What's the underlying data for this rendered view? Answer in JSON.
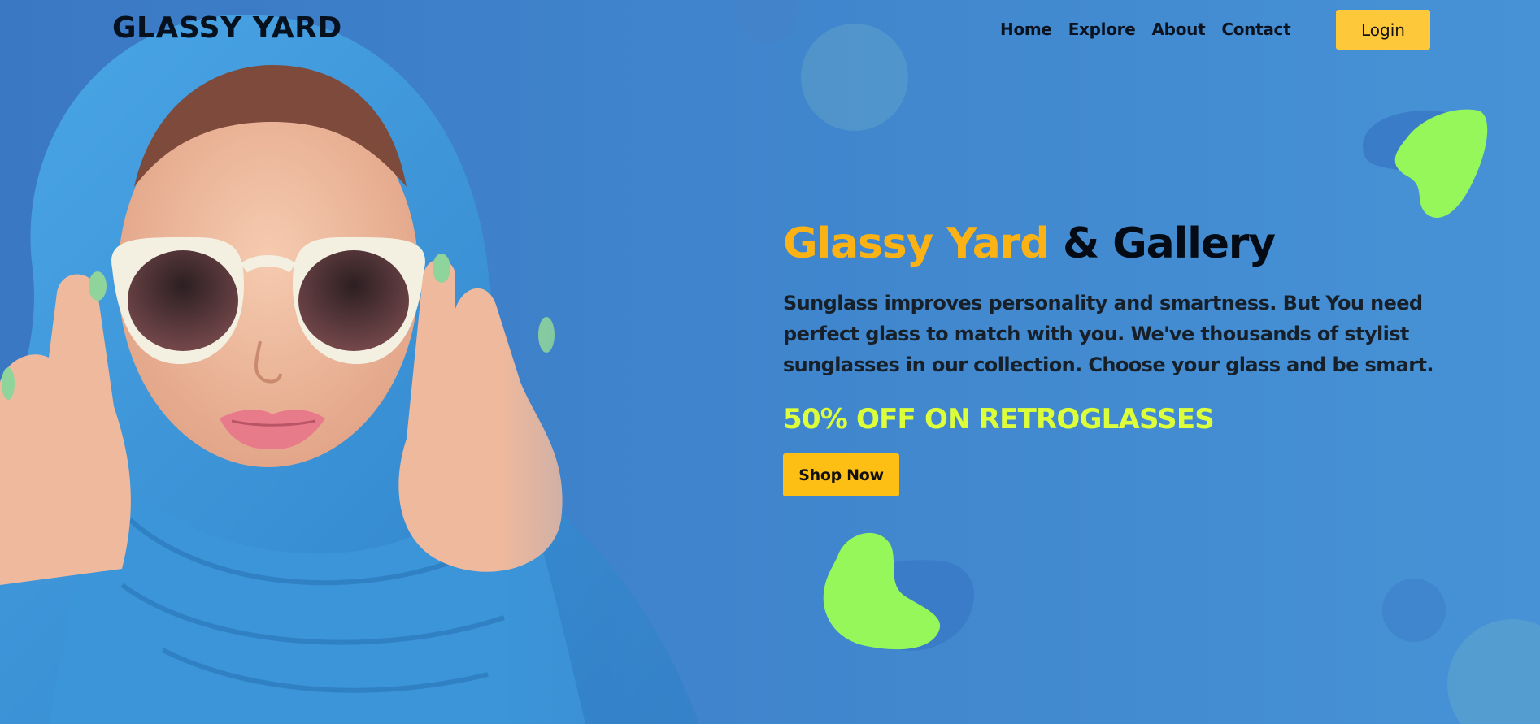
{
  "brand": {
    "logo_text": "GLASSY YARD"
  },
  "nav": {
    "items": [
      {
        "label": "Home"
      },
      {
        "label": "Explore"
      },
      {
        "label": "About"
      },
      {
        "label": "Contact"
      }
    ],
    "login_label": "Login"
  },
  "hero": {
    "title_accent": "Glassy Yard",
    "title_rest": "& Gallery",
    "description": "Sunglass improves personality and smartness. But You need perfect glass to match with you. We've thousands of stylist sunglasses in our collection. Choose your glass and be smart.",
    "promo": "50% OFF ON RETROGLASSES",
    "cta_label": "Shop Now",
    "image_subject": "woman-with-sunglasses-and-blue-scarf"
  },
  "colors": {
    "background": "#4590d4",
    "accent_yellow": "#fbb215",
    "button_yellow": "#fdc93a",
    "promo_lime": "#dcff3a",
    "blob_green": "#96f75a",
    "text_dark": "#06111d"
  }
}
